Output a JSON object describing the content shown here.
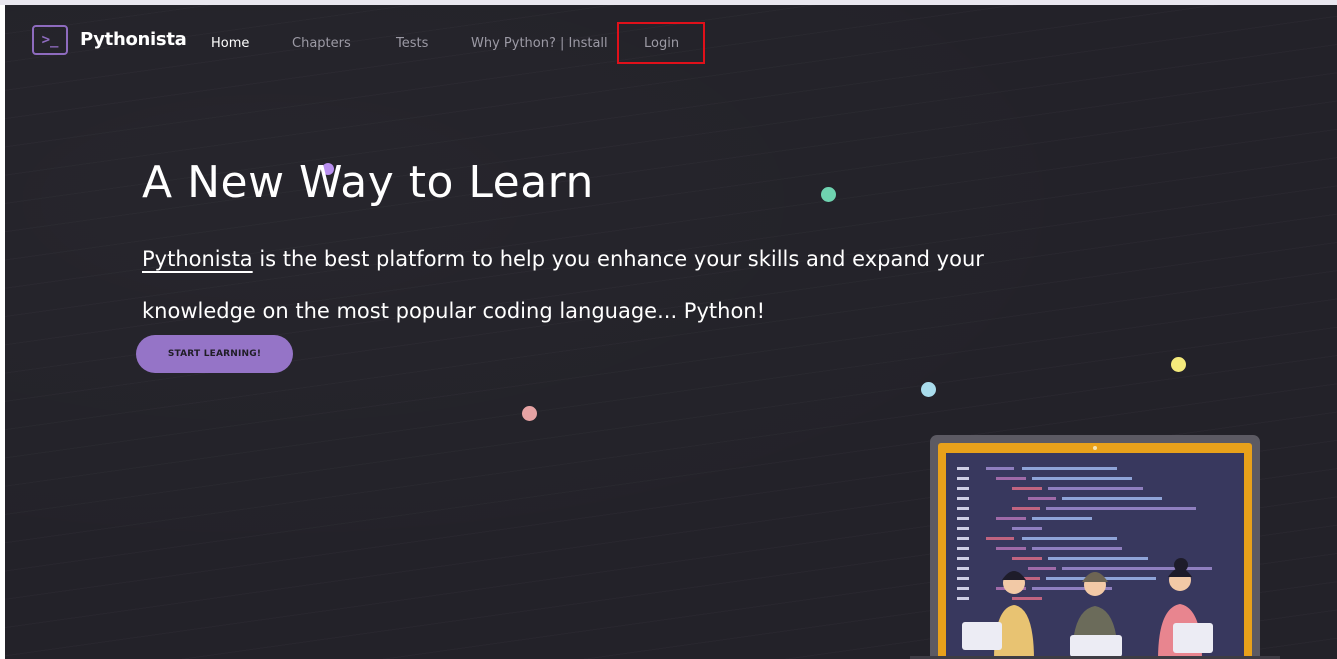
{
  "nav": {
    "logo_glyph": ">_",
    "brand": "Pythonista",
    "links": [
      "Home",
      "Chapters",
      "Tests",
      "Why Python? | Install",
      "Login"
    ],
    "active": "Home"
  },
  "hero": {
    "title": "A New Way to Learn",
    "brand_link": "Pythonista",
    "text": " is the best platform to help you enhance your skills and expand your knowledge on the most popular coding language... Python!",
    "cta": "START LEARNING!"
  },
  "colors": {
    "background": "#232229",
    "accent": "#9574c7",
    "highlight": "#e0101a",
    "dots": [
      "#b98ff0",
      "#6fd3b0",
      "#f4ea7c",
      "#a9dcec",
      "#e6a3a4"
    ]
  },
  "icons": [
    "terminal-icon",
    "laptop-illustration"
  ]
}
